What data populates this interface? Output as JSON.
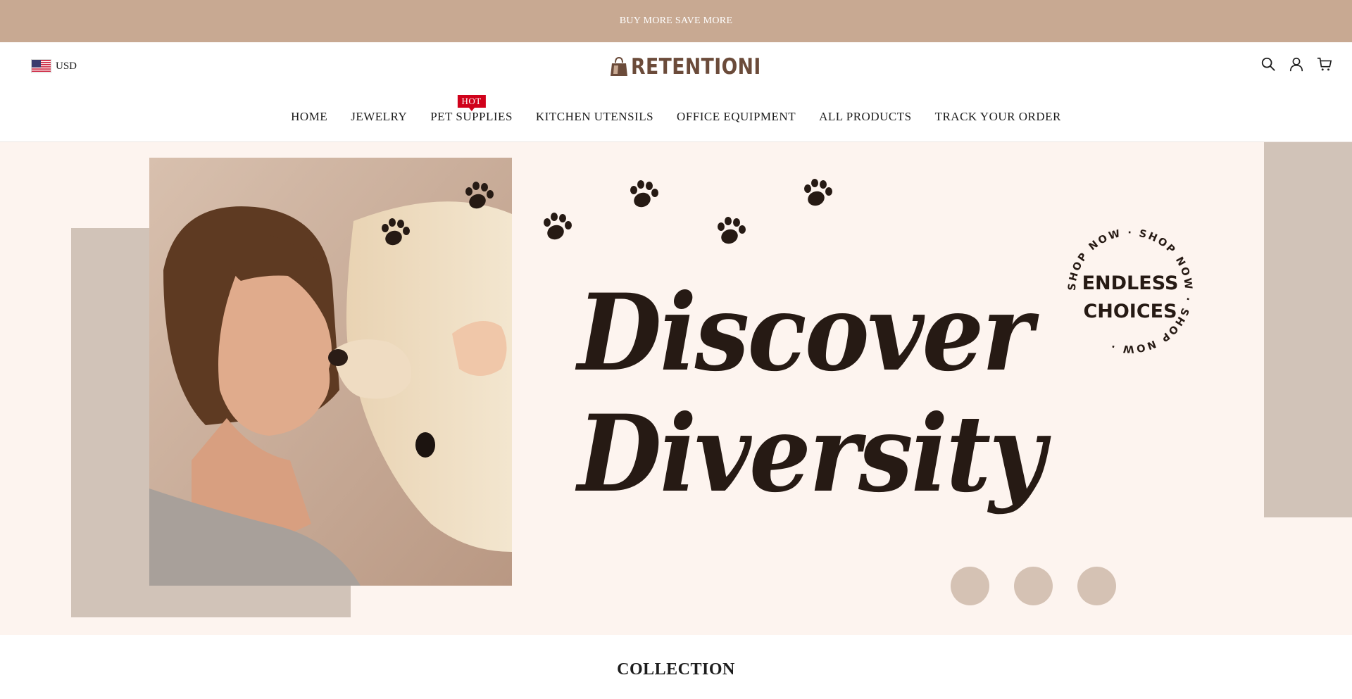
{
  "announcement": {
    "text": "\u0000BUY MORE SAVE MORE\u0000"
  },
  "header": {
    "currency": {
      "code": "USD",
      "flag_icon": "us-flag-icon"
    },
    "logo": {
      "text": "RETENTIONI",
      "icon": "bag-logo-icon"
    },
    "icons": [
      "search-icon",
      "account-icon",
      "cart-icon"
    ]
  },
  "nav": {
    "items": [
      {
        "label": "HOME"
      },
      {
        "label": "JEWELRY"
      },
      {
        "label": "PET SUPPLIES",
        "badge": "HOT"
      },
      {
        "label": "KITCHEN UTENSILS"
      },
      {
        "label": "OFFICE EQUIPMENT"
      },
      {
        "label": "ALL PRODUCTS"
      },
      {
        "label": "TRACK YOUR ORDER"
      }
    ]
  },
  "hero": {
    "headline_line1": "Discover",
    "headline_line2": "Diversity",
    "badge_main_line1": "ENDLESS",
    "badge_main_line2": "CHOICES",
    "badge_ring_text": "SHOP NOW · SHOP NOW · SHOP NOW · ",
    "slide_count": 3
  },
  "collection": {
    "title": "COLLECTION"
  },
  "colors": {
    "announcement_bg": "#c8a992",
    "hero_bg": "#fdf4ef",
    "deco_block": "#d1c3b8",
    "hot_badge": "#d0021b",
    "logo": "#6b4b3a",
    "headline": "#261a14"
  }
}
